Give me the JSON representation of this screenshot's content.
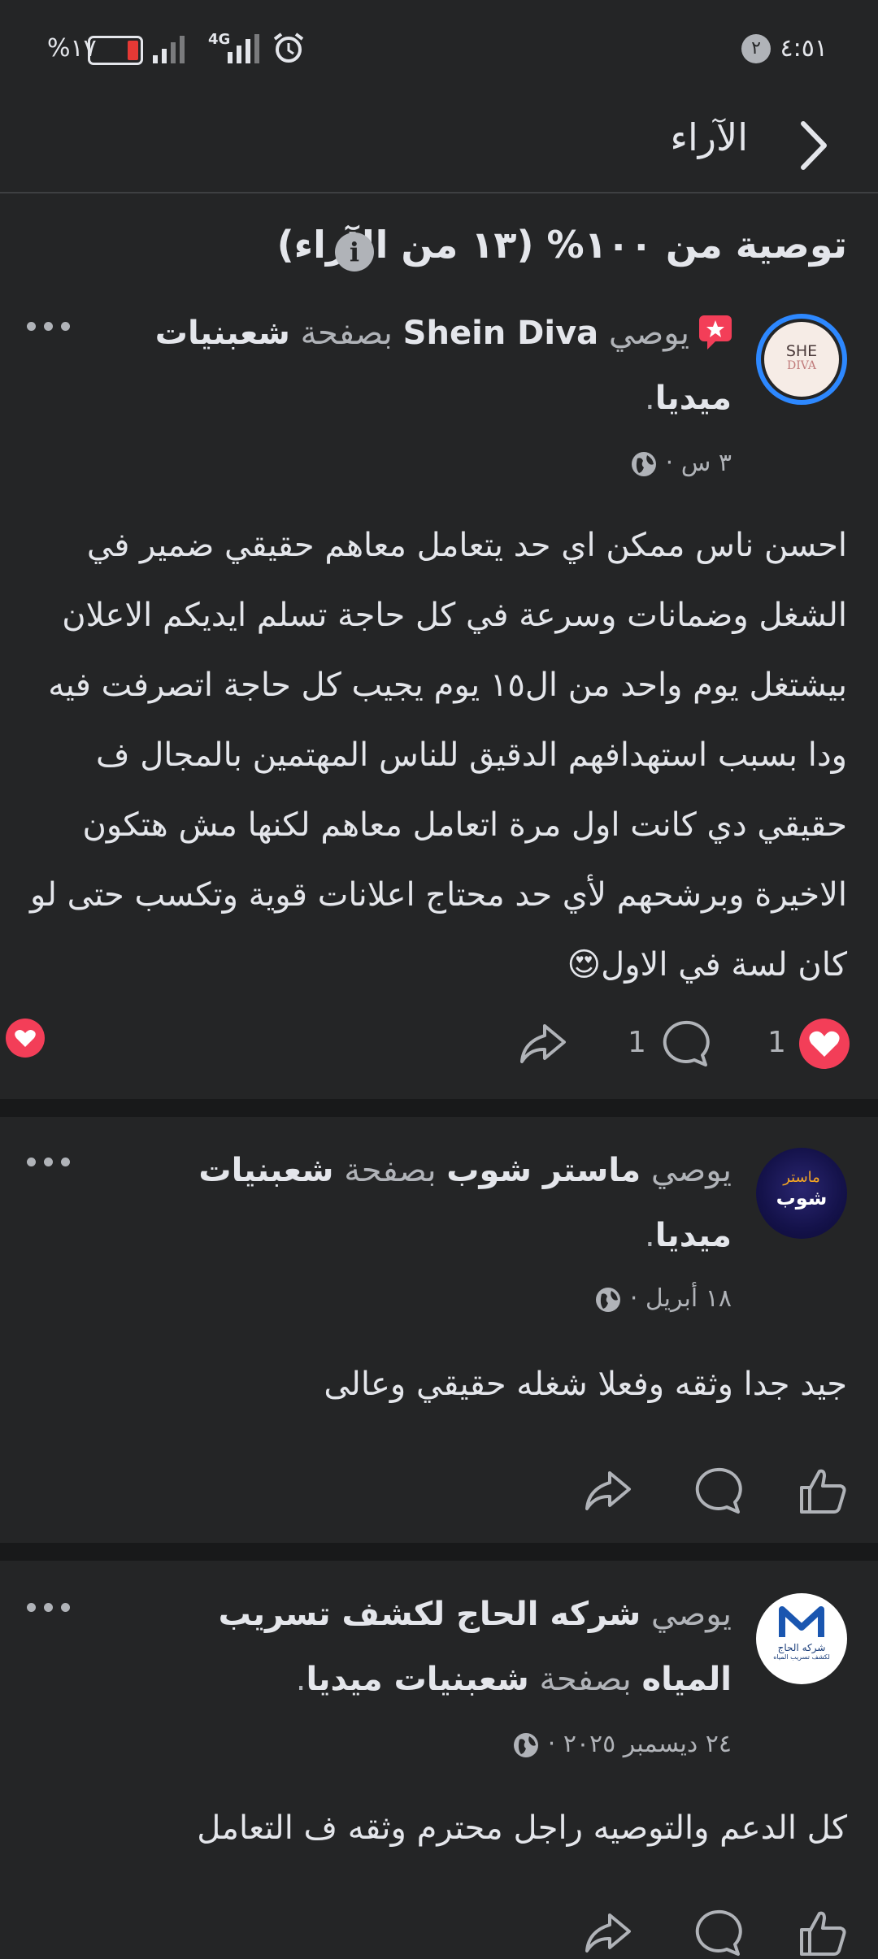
{
  "status_bar": {
    "time": "٤:٥١",
    "notification_count": "٢",
    "battery": "%١٧",
    "network": "4G"
  },
  "header": {
    "title": "الآراء"
  },
  "summary": {
    "text": "توصية من ١٠٠% (١٣ من الآراء)"
  },
  "posts": [
    {
      "recommends": "يوصي",
      "author": "Shein Diva",
      "page_prefix": "بصفحة",
      "page_name": "شعبنيات ميديا",
      "period": ".",
      "time": "٣ س ·",
      "avatar_text_1": "SHE",
      "avatar_text_2": "DIVA",
      "text": "احسن ناس ممكن اي حد يتعامل معاهم حقيقي ضمير في الشغل وضمانات وسرعة في كل حاجة تسلم ايديكم الاعلان بيشتغل يوم واحد من ال١٥ يوم يجيب كل حاجة اتصرفت فيه ودا بسبب استهدافهم الدقيق للناس المهتمين بالمجال ف حقيقي دي كانت اول مرة اتعامل معاهم لكنها مش هتكون الاخيرة وبرشحهم لأي حد محتاج اعلانات قوية وتكسب حتى لو كان لسة في الاول😍",
      "likes": "1",
      "comments": "1"
    },
    {
      "recommends": "يوصي",
      "author": "ماستر شوب",
      "page_prefix": "بصفحة",
      "page_name": "شعبنيات ميديا",
      "period": ".",
      "time": "١٨ أبريل ·",
      "avatar_text_1": "ماستر",
      "avatar_text_2": "شوب",
      "text": "جيد جدا وثقه وفعلا شغله حقيقي وعالى"
    },
    {
      "recommends": "يوصي",
      "author": "شركه الحاج لكشف تسريب المياه",
      "page_prefix": "بصفحة",
      "page_name": "شعبنيات ميديا",
      "period": ".",
      "time": "٢٤ ديسمبر ٢٠٢٥ ·",
      "avatar_text_1": "شركه الحاج",
      "avatar_text_2": "لكشف تسريب المياه",
      "text": "كل الدعم والتوصيه راجل محترم وثقه ف التعامل"
    }
  ],
  "colors": {
    "background": "#242526",
    "like_red": "#f33e58",
    "avatar_ring": "#2d88ff",
    "divider": "#18191a"
  }
}
